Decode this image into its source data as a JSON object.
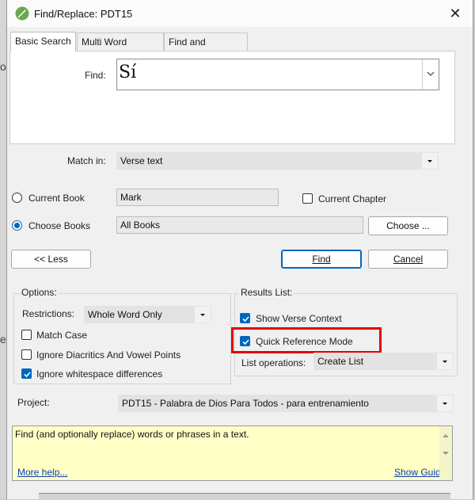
{
  "window": {
    "title": "Find/Replace: PDT15",
    "close_glyph": "✕"
  },
  "background_marks": {
    "m1": "o",
    "m2": "e"
  },
  "tabs": [
    {
      "label": "Basic Search",
      "active": true
    },
    {
      "label": "Multi Word Search",
      "active": false
    },
    {
      "label": "Find and Replace",
      "active": false
    }
  ],
  "find": {
    "label": "Find:",
    "value": "Sí"
  },
  "match_in": {
    "label": "Match in:",
    "value": "Verse text"
  },
  "scope": {
    "current_book": {
      "label": "Current Book",
      "value": "Mark",
      "selected": false
    },
    "choose_books": {
      "label": "Choose Books",
      "value": "All Books",
      "selected": true
    },
    "current_chapter": {
      "label": "Current Chapter",
      "checked": false
    },
    "choose_button": "Choose ..."
  },
  "buttons": {
    "less": "<< Less",
    "find": "Find",
    "cancel": "Cancel"
  },
  "options": {
    "title": "Options:",
    "restrictions_label": "Restrictions:",
    "restrictions_value": "Whole Word Only",
    "match_case": {
      "label": "Match Case",
      "checked": false
    },
    "ignore_diacritics": {
      "label": "Ignore Diacritics And Vowel Points",
      "checked": false
    },
    "ignore_whitespace": {
      "label": "Ignore whitespace differences",
      "checked": true
    }
  },
  "results": {
    "title": "Results List:",
    "show_verse_context": {
      "label": "Show Verse Context",
      "checked": true
    },
    "quick_reference_mode": {
      "label": "Quick Reference Mode",
      "checked": true
    },
    "list_operations_label": "List operations:",
    "list_operations_value": "Create List"
  },
  "project": {
    "label": "Project:",
    "value": "PDT15 -  Palabra de Dios Para Todos - para entrenamiento"
  },
  "help": {
    "text": "Find (and optionally replace) words or phrases in a text.",
    "more_help": "More help...",
    "show_guide": "Show Guide"
  },
  "colors": {
    "accent": "#0067c0",
    "highlight": "#e60000",
    "help_bg": "#ffffc6"
  }
}
